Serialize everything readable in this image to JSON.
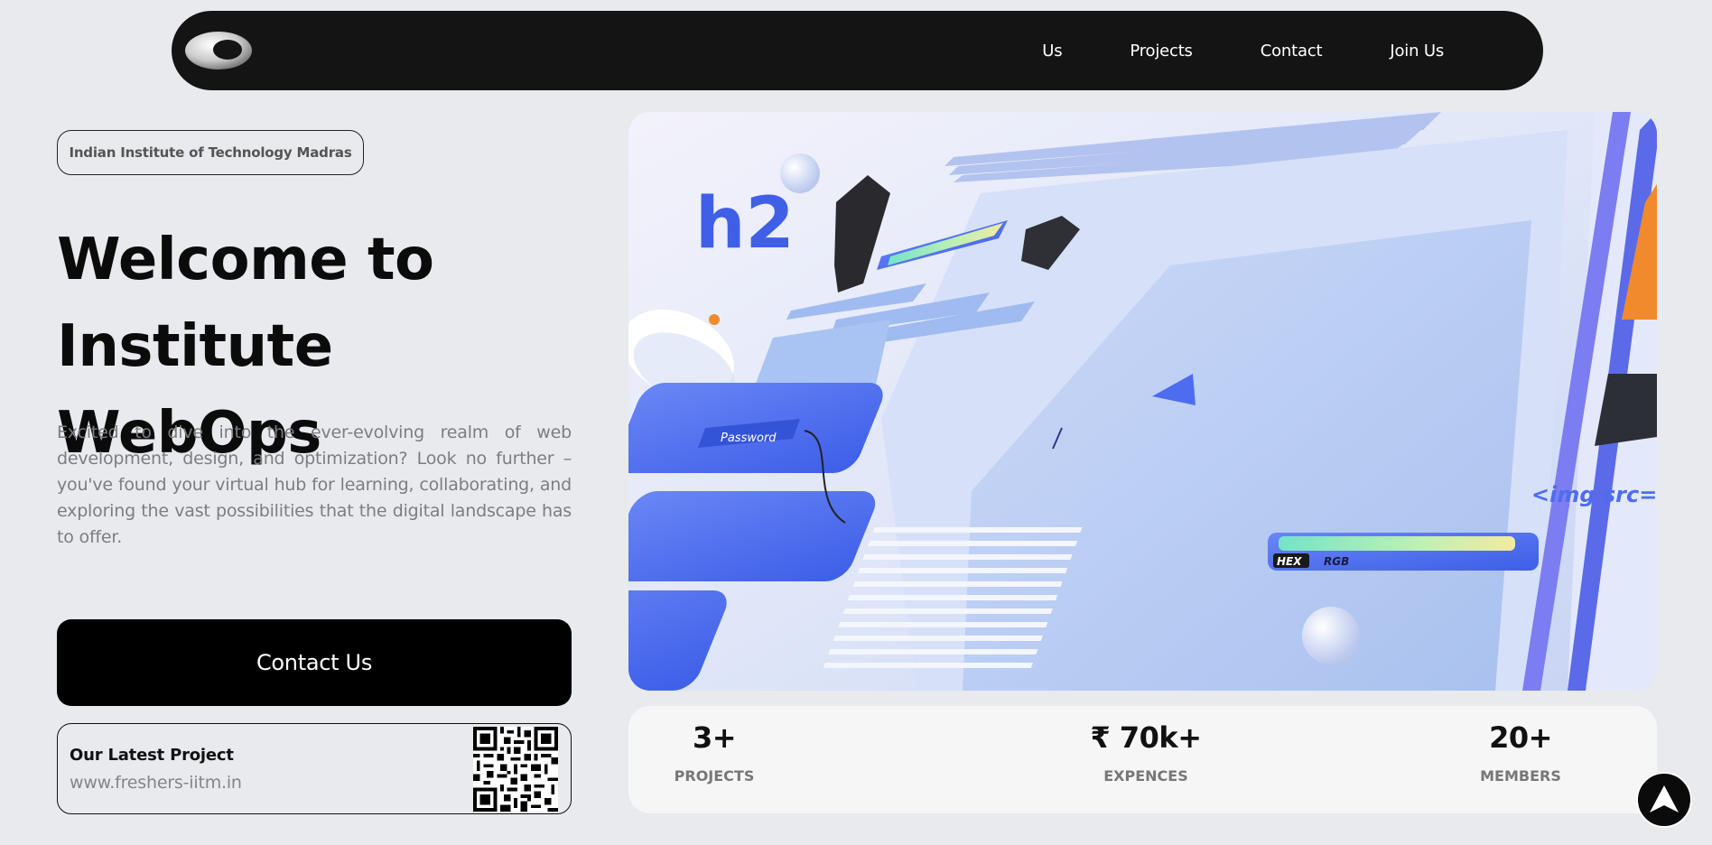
{
  "nav": {
    "logo_icon": "eye-logo-icon",
    "links": [
      "Us",
      "Projects",
      "Contact",
      "Join Us"
    ]
  },
  "hero": {
    "institute": "Indian Institute of Technology Madras",
    "title_line1": "Welcome to",
    "title_line2": "Institute WebOps",
    "description": "Excited to dive into the ever-evolving realm of web development, design, and optimization? Look no further – you've found your virtual hub for learning, collaborating, and exploring the vast possibilities that the digital landscape has to offer.",
    "cta_label": "Contact Us"
  },
  "latest_project": {
    "title": "Our Latest Project",
    "url": "www.freshers-iitm.in",
    "qr_icon": "qr-code-icon"
  },
  "illustration": {
    "h2_text": "h2",
    "password_text": "Password",
    "hex_text": "HEX",
    "rgb_text": "RGB",
    "img_src_text": "<img src="
  },
  "stats": [
    {
      "value": "3+",
      "label": "PROJECTS"
    },
    {
      "value": "₹ 70k+",
      "label": "EXPENCES"
    },
    {
      "value": "20+",
      "label": "MEMBERS"
    }
  ],
  "fab_icon": "arrow-up-icon",
  "colors": {
    "background": "#e9eaed",
    "nav": "#141414",
    "accent_blue": "#4e6cf0",
    "button": "#000000"
  }
}
